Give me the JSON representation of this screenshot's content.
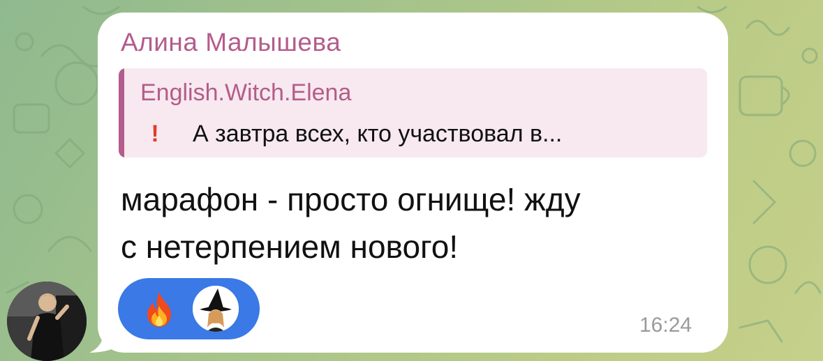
{
  "message": {
    "sender_name": "Алина Малышева",
    "reply": {
      "author": "English.Witch.Elena",
      "emoji": "!",
      "text": "А завтра всех, кто участвовал в..."
    },
    "text": "марафон - просто огнище! жду\nс нетерпением нового!",
    "time": "16:24",
    "reactions": [
      {
        "emoji": "fire-icon"
      },
      {
        "emoji": "witch-avatar"
      }
    ]
  },
  "colors": {
    "accent": "#b45c8c",
    "reaction_bg": "#3a79e6",
    "bubble": "#ffffff",
    "reply_bg": "#f7e9ef"
  }
}
